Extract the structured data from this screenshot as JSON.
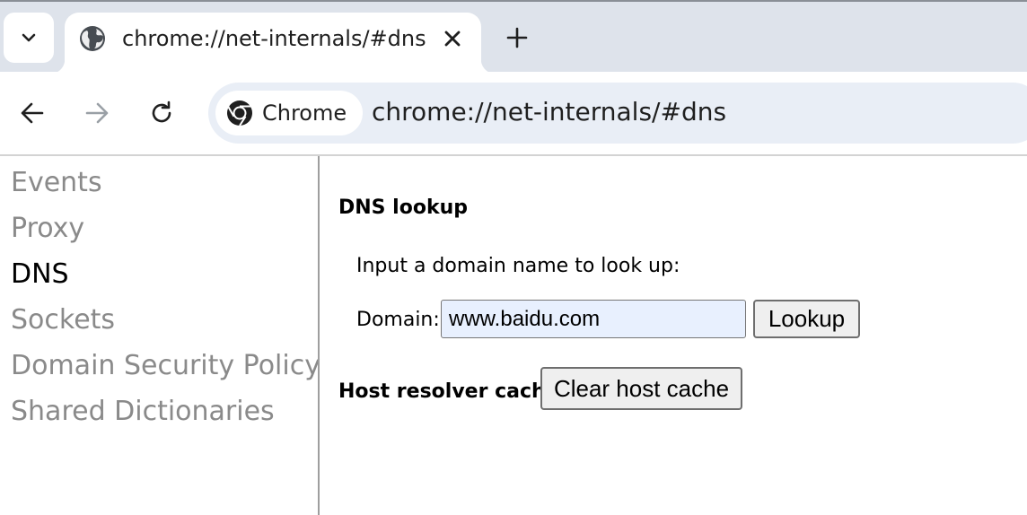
{
  "tab": {
    "title": "chrome://net-internals/#dns",
    "favicon": "globe-icon"
  },
  "toolbar": {
    "chip_label": "Chrome",
    "url": "chrome://net-internals/#dns",
    "back_icon": "back-arrow-icon",
    "forward_icon": "forward-arrow-icon",
    "reload_icon": "reload-icon"
  },
  "sidebar": {
    "items": [
      {
        "label": "Events",
        "selected": false
      },
      {
        "label": "Proxy",
        "selected": false
      },
      {
        "label": "DNS",
        "selected": true
      },
      {
        "label": "Sockets",
        "selected": false
      },
      {
        "label": "Domain Security Policy",
        "selected": false
      },
      {
        "label": "Shared Dictionaries",
        "selected": false
      }
    ]
  },
  "main": {
    "dns_lookup_heading": "DNS lookup",
    "instruction": "Input a domain name to look up:",
    "domain_label": "Domain:",
    "domain_value": "www.baidu.com",
    "lookup_button": "Lookup",
    "host_cache_heading": "Host resolver cache",
    "clear_cache_button": "Clear host cache"
  },
  "colors": {
    "tabstrip_bg": "#dee3eb",
    "omnibox_bg": "#e9eef6",
    "input_bg": "#e8f0fe",
    "sidebar_inactive": "#8a8a8a",
    "sidebar_active": "#000000"
  }
}
